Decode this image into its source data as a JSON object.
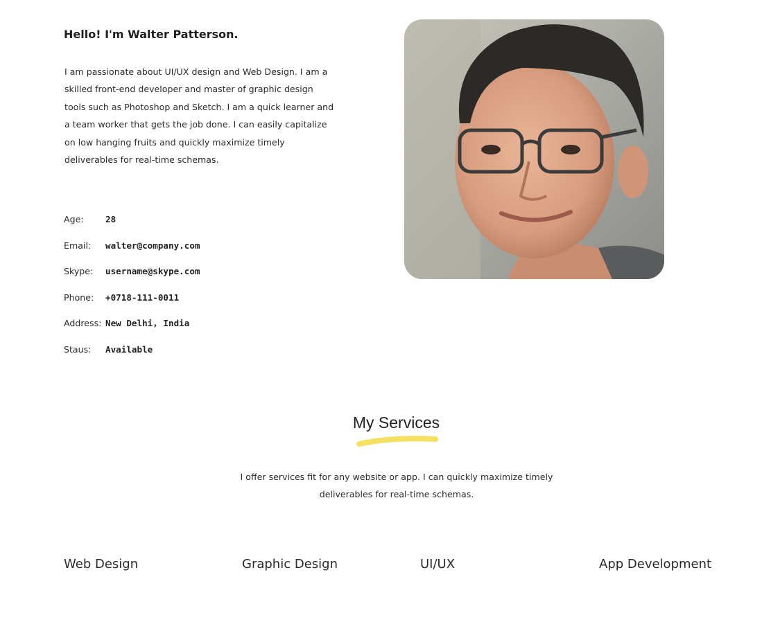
{
  "about": {
    "greeting": "Hello! I'm Walter Patterson.",
    "bio": "I am passionate about UI/UX design and Web Design. I am a skilled front-end developer and master of graphic design tools such as Photoshop and Sketch. I am a quick learner and a team worker that gets the job done. I can easily capitalize on low hanging fruits and quickly maximize timely deliverables for real-time schemas.",
    "info": [
      {
        "label": "Age:",
        "value": "28"
      },
      {
        "label": "Email:",
        "value": "walter@company.com"
      },
      {
        "label": "Skype:",
        "value": "username@skype.com"
      },
      {
        "label": "Phone:",
        "value": "+0718-111-0011"
      },
      {
        "label": "Address:",
        "value": "New Delhi, India"
      },
      {
        "label": "Staus:",
        "value": "Available"
      }
    ]
  },
  "services": {
    "title": "My Services",
    "description": "I offer services fit for any website or app. I can quickly maximize timely deliverables for real-time schemas.",
    "items": [
      "Web Design",
      "Graphic Design",
      "UI/UX",
      "App Development"
    ]
  },
  "colors": {
    "accent_underline": "#f4e063",
    "text": "#222222",
    "background": "#ffffff"
  }
}
